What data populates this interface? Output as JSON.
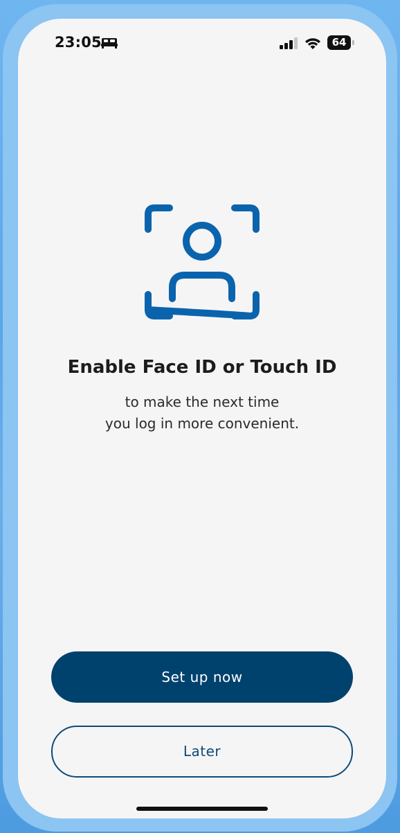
{
  "status_bar": {
    "time": "23:05",
    "focus_icon": "bed-icon",
    "battery_level": "64"
  },
  "main": {
    "icon": "face-id-icon",
    "title": "Enable Face ID or Touch ID",
    "subtitle_line1": "to make the next time",
    "subtitle_line2": "you log in more convenient."
  },
  "actions": {
    "primary_label": "Set up now",
    "secondary_label": "Later"
  },
  "colors": {
    "accent": "#0a64ad",
    "primary_button": "#00426e",
    "background": "#f5f5f6"
  }
}
